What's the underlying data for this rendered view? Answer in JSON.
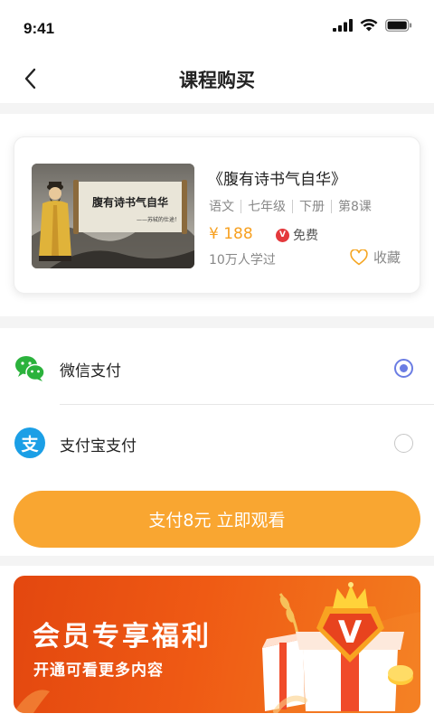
{
  "status_bar": {
    "time": "9:41"
  },
  "nav": {
    "title": "课程购买"
  },
  "course": {
    "title": "《腹有诗书气自华》",
    "thumb_text": "腹有诗书气自华",
    "thumb_subtext": "——苏轼的仕途！",
    "tags": [
      "语文",
      "七年级",
      "下册",
      "第8课"
    ],
    "price": "¥ 188",
    "vip_badge": "V",
    "vip_label": "免费",
    "learners": "10万人学过",
    "favorite_label": "收藏"
  },
  "payment": {
    "options": [
      {
        "label": "微信支付",
        "icon": "wechat-icon",
        "selected": true
      },
      {
        "label": "支付宝支付",
        "icon": "alipay-icon",
        "selected": false
      }
    ],
    "alipay_glyph": "支",
    "pay_button": "支付8元  立即观看"
  },
  "promo": {
    "title": "会员专享福利",
    "subtitle": "开通可看更多内容",
    "crown_letter": "V"
  },
  "colors": {
    "accent": "#f9a631",
    "price": "#f7a020",
    "radio": "#6b7de3",
    "wechat": "#2bb23c",
    "alipay": "#1b9fe6",
    "promo": "#ef5a14",
    "heart": "#f5a623"
  }
}
